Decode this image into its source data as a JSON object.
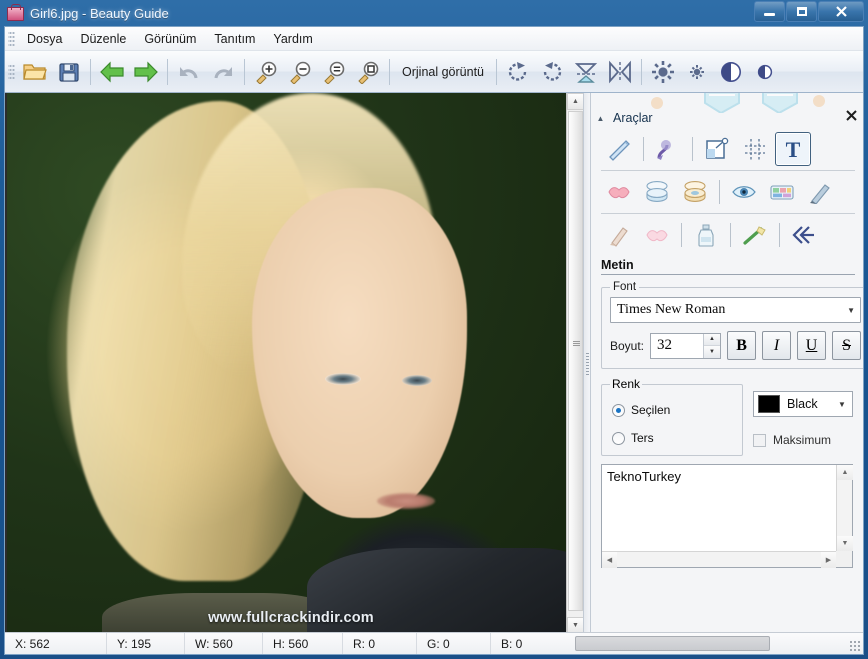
{
  "window": {
    "title": "Girl6.jpg - Beauty Guide",
    "icon": "beauty-bag-icon",
    "controls": {
      "minimize": "–",
      "maximize": "□",
      "close": "✕"
    }
  },
  "menubar": {
    "items": [
      {
        "label": "Dosya",
        "name": "menu-dosya"
      },
      {
        "label": "Düzenle",
        "name": "menu-duzenle"
      },
      {
        "label": "Görünüm",
        "name": "menu-gorunum"
      },
      {
        "label": "Tanıtım",
        "name": "menu-tanitim"
      },
      {
        "label": "Yardım",
        "name": "menu-yardim"
      }
    ]
  },
  "toolbar": {
    "open_icon": "open-folder-icon",
    "save_icon": "save-disk-icon",
    "back_icon": "arrow-left-green-icon",
    "forward_icon": "arrow-right-green-icon",
    "undo_icon": "undo-icon",
    "redo_icon": "redo-icon",
    "zoom_in_icon": "zoom-in-icon",
    "zoom_out_icon": "zoom-out-icon",
    "zoom_actual_icon": "zoom-actual-size-icon",
    "zoom_fit_icon": "zoom-fit-window-icon",
    "original_label": "Orjinal görüntü",
    "rotate_cw_icon": "rotate-clockwise-icon",
    "rotate_ccw_icon": "rotate-counterclockwise-icon",
    "flip_vertical_icon": "flip-vertical-icon",
    "flip_horizontal_icon": "flip-horizontal-icon",
    "brightness_up_icon": "brightness-increase-icon",
    "brightness_down_icon": "brightness-decrease-icon",
    "contrast_up_icon": "contrast-increase-icon",
    "contrast_down_icon": "contrast-decrease-icon"
  },
  "canvas": {
    "watermark": "www.fullcrackindir.com",
    "scroll_up_icon": "scroll-up-arrow-icon",
    "scroll_down_icon": "scroll-down-arrow-icon"
  },
  "panel": {
    "title": "Araçlar",
    "collapse_icon": "chevron-up-icon",
    "close_icon": "close-x-icon",
    "tool_rows": [
      [
        {
          "name": "tool-wand",
          "icon": "wand-icon",
          "selected": false
        },
        {
          "sep": true
        },
        {
          "name": "tool-brush",
          "icon": "paint-brush-icon",
          "selected": false
        },
        {
          "sep": true
        },
        {
          "name": "tool-crop",
          "icon": "crop-resize-icon",
          "selected": false
        },
        {
          "name": "tool-transform",
          "icon": "transform-grid-icon",
          "selected": false
        },
        {
          "name": "tool-text",
          "icon": "text-T-icon",
          "selected": true
        }
      ],
      [
        {
          "name": "tool-lips",
          "icon": "lips-icon",
          "selected": false
        },
        {
          "name": "tool-powder",
          "icon": "powder-compact-icon",
          "selected": false
        },
        {
          "name": "tool-blush",
          "icon": "blush-compact-icon",
          "selected": false
        },
        {
          "sep": true
        },
        {
          "name": "tool-eye",
          "icon": "eye-icon",
          "selected": false
        },
        {
          "name": "tool-eyeshadow",
          "icon": "eyeshadow-palette-icon",
          "selected": false
        },
        {
          "name": "tool-eyeliner-pencil",
          "icon": "pencil-icon",
          "selected": false
        }
      ],
      [
        {
          "name": "tool-foundation",
          "icon": "foundation-tube-icon",
          "selected": false
        },
        {
          "name": "tool-lipgloss",
          "icon": "lip-gloss-icon",
          "selected": false
        },
        {
          "sep": true
        },
        {
          "name": "tool-skin-whitening",
          "icon": "lotion-bottle-icon",
          "selected": false
        },
        {
          "sep": true
        },
        {
          "name": "tool-teeth-whitening",
          "icon": "toothbrush-icon",
          "selected": false
        },
        {
          "sep": true
        },
        {
          "name": "tool-undo-effect",
          "icon": "rewind-arrows-icon",
          "selected": false
        }
      ]
    ],
    "metin": {
      "section_label": "Metin",
      "font_group_label": "Font",
      "font_family": "Times New Roman",
      "font_dropdown_icon": "chevron-down-icon",
      "size_label": "Boyut:",
      "size_value": "32",
      "spin_up_icon": "spinner-up-icon",
      "spin_down_icon": "spinner-down-icon",
      "bold_label": "B",
      "italic_label": "I",
      "underline_label": "U",
      "strike_label": "S",
      "renk_group_label": "Renk",
      "radio_selected_label": "Seçilen",
      "radio_inverse_label": "Ters",
      "radio_selected_on": true,
      "radio_inverse_on": false,
      "color_value": "Black",
      "color_hex": "#000000",
      "color_dropdown_icon": "chevron-down-icon",
      "maximum_label": "Maksimum",
      "maximum_checked": false,
      "text_content": "TeknoTurkey",
      "textarea_up_icon": "scroll-up-arrow-icon",
      "textarea_down_icon": "scroll-down-arrow-icon",
      "textarea_left_icon": "scroll-left-arrow-icon",
      "textarea_right_icon": "scroll-right-arrow-icon"
    }
  },
  "statusbar": {
    "x": "X: 562",
    "y": "Y: 195",
    "w": "W: 560",
    "h": "H: 560",
    "r": "R: 0",
    "g": "G: 0",
    "b": "B: 0"
  },
  "colors": {
    "title_blue": "#1d5b98",
    "accent": "#41617f",
    "panel_bg": "#fbfcfd"
  }
}
